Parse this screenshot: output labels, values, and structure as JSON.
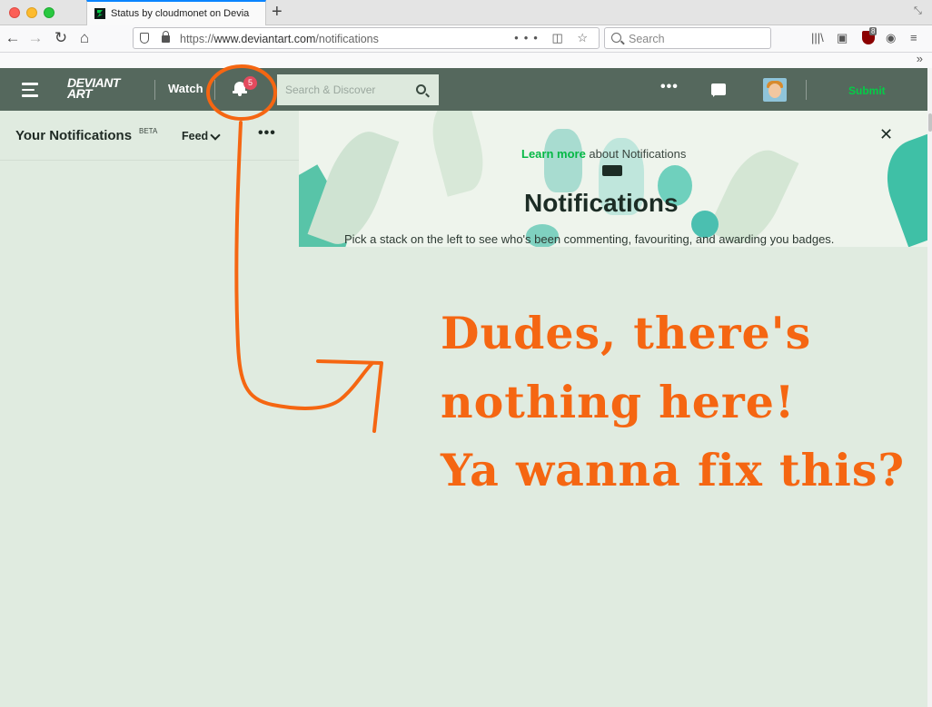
{
  "browser": {
    "tab_title": "Status by cloudmonet on Devia",
    "url_scheme": "https://",
    "url_host": "www.deviantart.com",
    "url_path": "/notifications",
    "search_placeholder": "Search",
    "ublock_count": "8"
  },
  "header": {
    "logo_line1": "DEVIANT",
    "logo_line2": "ART",
    "watch_label": "Watch",
    "notification_count": "5",
    "search_placeholder": "Search & Discover",
    "more_label": "•••",
    "submit_label": "Submit"
  },
  "notifications_panel": {
    "title": "Your Notifications",
    "beta_label": "BETA",
    "feed_label": "Feed",
    "more_label": "•••"
  },
  "banner": {
    "learn_more_link": "Learn more",
    "learn_more_suffix": " about Notifications",
    "heading": "Notifications",
    "subtext": "Pick a stack on the left to see who's been commenting, favouriting, and awarding you badges."
  },
  "annotation": {
    "lines": [
      "Dudes, there's",
      "nothing here!",
      "Ya wanna fix this?"
    ],
    "color": "#f56612"
  },
  "colors": {
    "header_bg": "#55685d",
    "page_bg": "#e0ebe0",
    "accent_green": "#05cc47",
    "badge_red": "#e44a5e"
  }
}
